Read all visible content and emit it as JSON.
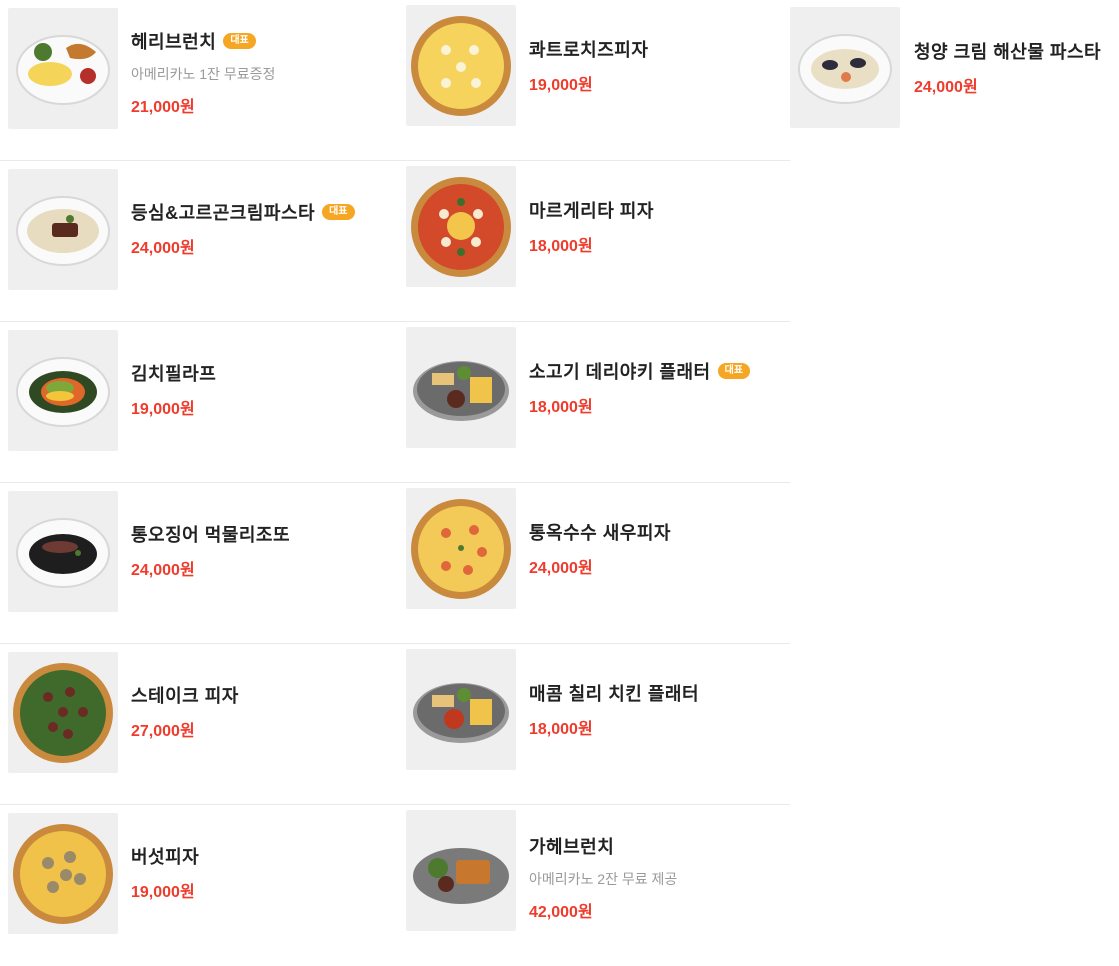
{
  "colors": {
    "price": "#ef3b2c",
    "badge": "#f5a623",
    "thumb_bg": "#efefef"
  },
  "columns": [
    {
      "items": [
        {
          "name": "헤리브런치",
          "badge": "대표",
          "desc": "아메리카노 1잔 무료증정",
          "price": "21,000원",
          "image": "brunch-plate"
        },
        {
          "name": "등심&고르곤크림파스타",
          "badge": "대표",
          "desc": "",
          "price": "24,000원",
          "image": "cream-pasta-steak"
        },
        {
          "name": "김치필라프",
          "badge": "",
          "desc": "",
          "price": "19,000원",
          "image": "kimchi-pilaf"
        },
        {
          "name": "통오징어 먹물리조또",
          "badge": "",
          "desc": "",
          "price": "24,000원",
          "image": "squid-ink-risotto"
        },
        {
          "name": "스테이크 피자",
          "badge": "",
          "desc": "",
          "price": "27,000원",
          "image": "steak-pizza"
        },
        {
          "name": "버섯피자",
          "badge": "",
          "desc": "",
          "price": "19,000원",
          "image": "mushroom-pizza"
        }
      ]
    },
    {
      "items": [
        {
          "name": "콰트로치즈피자",
          "badge": "",
          "desc": "",
          "price": "19,000원",
          "image": "quattro-cheese-pizza"
        },
        {
          "name": "마르게리타 피자",
          "badge": "",
          "desc": "",
          "price": "18,000원",
          "image": "margherita-pizza"
        },
        {
          "name": "소고기 데리야키 플래터",
          "badge": "대표",
          "desc": "",
          "price": "18,000원",
          "image": "beef-teriyaki-platter"
        },
        {
          "name": "통옥수수 새우피자",
          "badge": "",
          "desc": "",
          "price": "24,000원",
          "image": "corn-shrimp-pizza"
        },
        {
          "name": "매콤 칠리 치킨 플래터",
          "badge": "",
          "desc": "",
          "price": "18,000원",
          "image": "chili-chicken-platter"
        },
        {
          "name": "가헤브런치",
          "badge": "",
          "desc": "아메리카노 2잔 무료 제공",
          "price": "42,000원",
          "image": "brunch-platter"
        }
      ]
    },
    {
      "items": [
        {
          "name": "청양 크림 해산물 파스타",
          "badge": "",
          "desc": "",
          "price": "24,000원",
          "image": "seafood-cream-pasta"
        }
      ]
    }
  ]
}
